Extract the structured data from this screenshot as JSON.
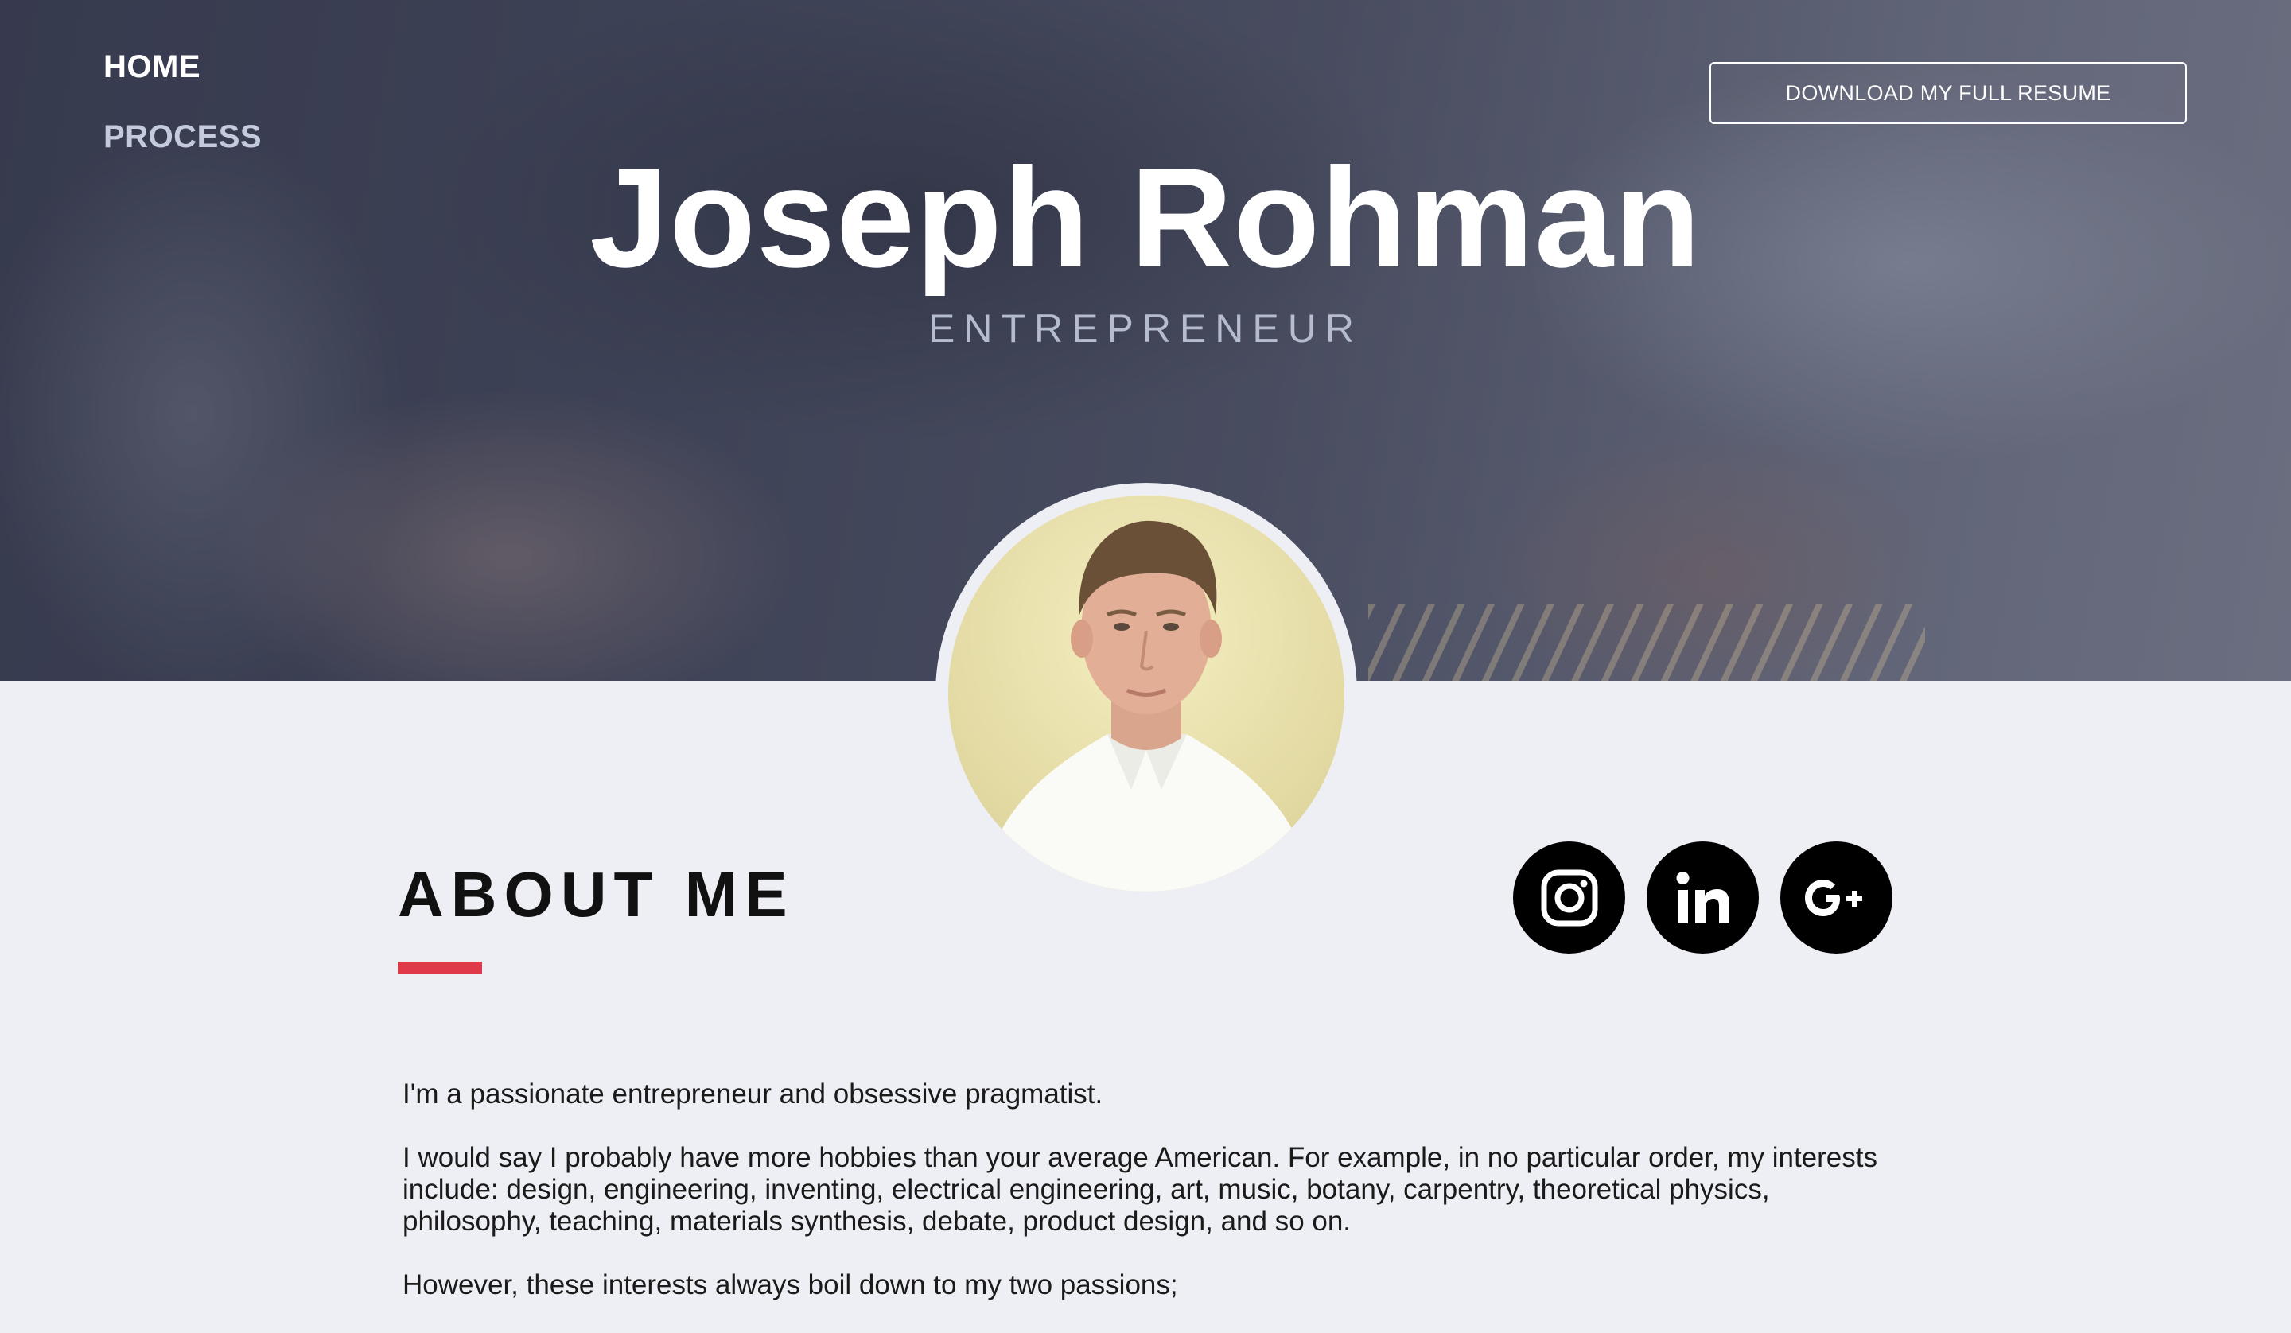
{
  "nav": {
    "items": [
      {
        "label": "HOME"
      },
      {
        "label": "PROCESS"
      }
    ]
  },
  "header": {
    "resume_button": "DOWNLOAD MY FULL RESUME",
    "name": "Joseph Rohman",
    "title": "ENTREPRENEUR"
  },
  "about": {
    "heading": "ABOUT ME",
    "paragraphs": [
      "I'm a passionate entrepreneur and obsessive pragmatist.",
      "I would say I probably have more hobbies than your average American.  For example, in no particular order, my interests include: design, engineering, inventing, electrical engineering, art, music, botany, carpentry, theoretical physics, philosophy, teaching, materials synthesis, debate, product design, and so on.",
      "However, these interests always boil down to my two passions;"
    ]
  },
  "social": [
    {
      "icon": "instagram-icon"
    },
    {
      "icon": "linkedin-icon"
    },
    {
      "icon": "google-plus-icon"
    }
  ],
  "colors": {
    "accent": "#e0394a",
    "page_background": "#eeeff4",
    "social_circle": "#000000"
  }
}
